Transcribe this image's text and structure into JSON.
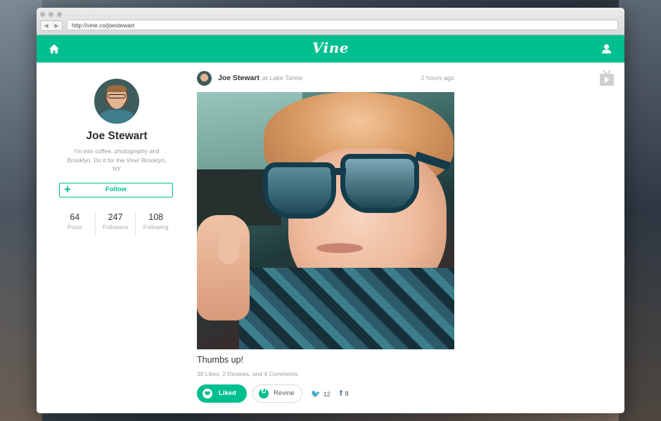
{
  "browser": {
    "url": "http://vine.co/joestewart"
  },
  "app": {
    "logo": "Vine",
    "colors": {
      "brand": "#00bf8f",
      "text": "#333333",
      "muted": "#a0a0a0"
    },
    "icons": {
      "home": "home-icon",
      "user": "user-icon",
      "tv": "tv-icon"
    }
  },
  "profile": {
    "name": "Joe Stewart",
    "bio": "I'm into coffee, photography and Brooklyn. Do it for the Vine! Brooklyn, NY",
    "follow_label": "Follow",
    "stats": [
      {
        "value": "64",
        "label": "Posts"
      },
      {
        "value": "247",
        "label": "Followers"
      },
      {
        "value": "108",
        "label": "Following"
      }
    ]
  },
  "post": {
    "author": "Joe Stewart",
    "location_prefix": "at",
    "location": "Lake Tahoe",
    "time": "2 hours ago",
    "caption": "Thumbs up!",
    "meta": "38 Likes, 2 Revines, and 4 Comments",
    "liked_label": "Liked",
    "revine_label": "Revine",
    "twitter_count": "12",
    "facebook_count": "8"
  }
}
